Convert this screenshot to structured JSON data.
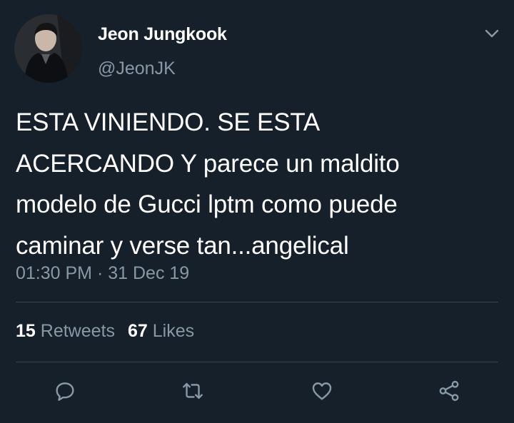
{
  "author": {
    "display_name": "Jeon Jungkook",
    "handle": "@JeonJK"
  },
  "tweet": {
    "lines": [
      "ESTA VINIENDO. SE ESTA",
      "ACERCANDO Y parece un maldito",
      "modelo de Gucci lptm como puede",
      "caminar y verse tan...angelical"
    ],
    "time": "01:30 PM",
    "separator": "·",
    "date": "31 Dec 19"
  },
  "stats": {
    "retweets_count": "15",
    "retweets_label": "Retweets",
    "likes_count": "67",
    "likes_label": "Likes"
  },
  "actions": {
    "icons": [
      "reply-icon",
      "retweet-icon",
      "like-icon",
      "share-icon"
    ]
  },
  "colors": {
    "background": "#15202b",
    "text": "#ffffff",
    "secondary": "#8899a6",
    "divider": "#38444d"
  }
}
